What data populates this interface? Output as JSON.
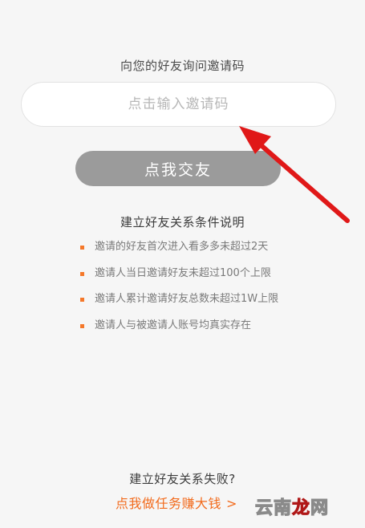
{
  "invite": {
    "prompt": "向您的好友询问邀请码",
    "input_placeholder": "点击输入邀请码",
    "input_value": "",
    "button_label": "点我交友"
  },
  "rules": {
    "title": "建立好友关系条件说明",
    "items": [
      "邀请的好友首次进入看多多未超过2天",
      "邀请人当日邀请好友未超过100个上限",
      "邀请人累计邀请好友总数未超过1W上限",
      "邀请人与被邀请人账号均真实存在"
    ]
  },
  "footer": {
    "fail_text": "建立好友关系失败?",
    "task_link_label": "点我做任务赚大钱",
    "task_link_chevron": ">"
  },
  "watermark": {
    "part1": "云南",
    "part2": "龙",
    "part3": "网"
  },
  "colors": {
    "accent": "#f26b1d",
    "bullet": "#f5782a",
    "button_bg": "#9b9b9b",
    "arrow": "#e01818",
    "background": "#f6f6f6"
  },
  "icons": {
    "bullet": "square-bullet-icon",
    "chevron": "chevron-right-icon",
    "arrow": "red-arrow-annotation-icon"
  }
}
